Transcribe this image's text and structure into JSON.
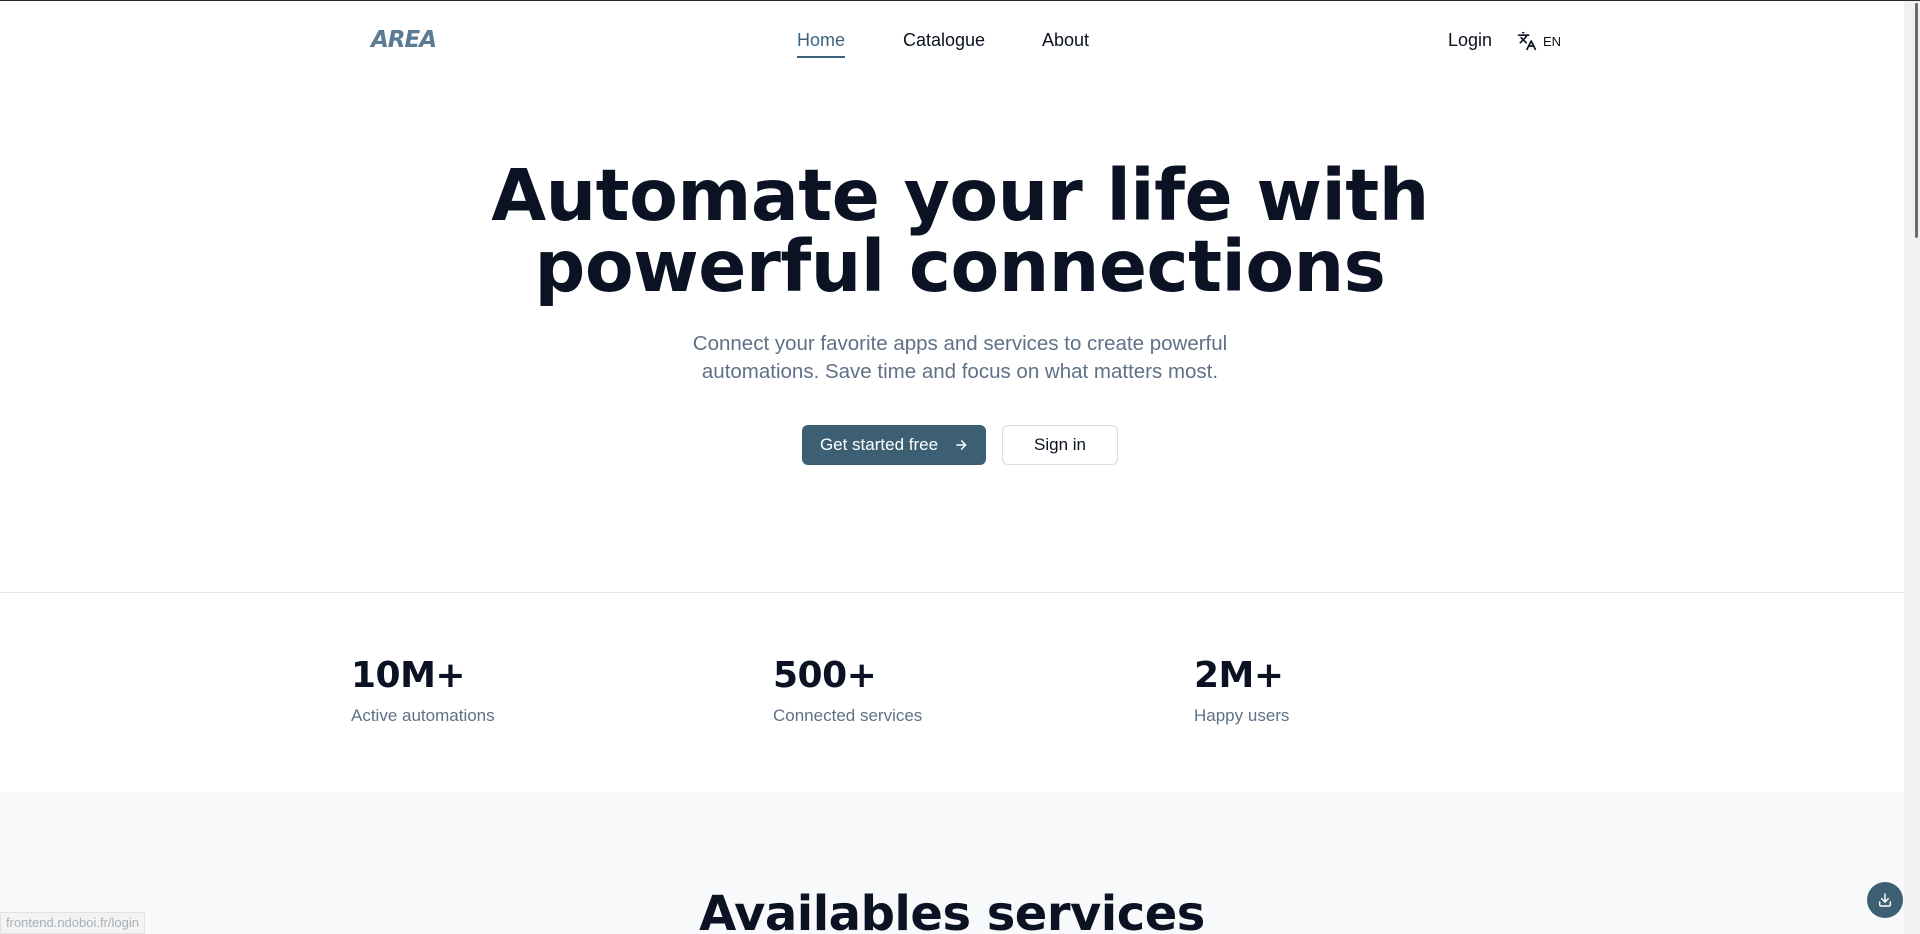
{
  "header": {
    "logo": "AREA",
    "nav": [
      {
        "label": "Home",
        "active": true
      },
      {
        "label": "Catalogue",
        "active": false
      },
      {
        "label": "About",
        "active": false
      }
    ],
    "login": "Login",
    "language": "EN"
  },
  "hero": {
    "title_line1": "Automate your life with",
    "title_line2": "powerful connections",
    "subtitle_line1": "Connect your favorite apps and services to create powerful",
    "subtitle_line2": "automations. Save time and focus on what matters most.",
    "primary_button": "Get started free",
    "secondary_button": "Sign in"
  },
  "stats": [
    {
      "value": "10M+",
      "label": "Active automations"
    },
    {
      "value": "500+",
      "label": "Connected services"
    },
    {
      "value": "2M+",
      "label": "Happy users"
    }
  ],
  "services": {
    "title": "Availables services"
  },
  "status_bar": {
    "url": "frontend.ndoboi.fr/login"
  },
  "colors": {
    "accent": "#3d5f73",
    "active_nav": "#3b6380",
    "heading": "#0b1224",
    "muted_text": "#5f7187"
  },
  "icons": {
    "language": "translate-icon",
    "primary_button": "arrow-right-icon",
    "fab": "download-icon"
  }
}
